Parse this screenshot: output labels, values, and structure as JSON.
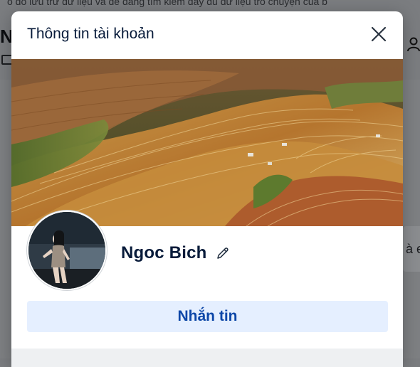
{
  "background": {
    "top_text": "ó do lưu trữ dữ liệu và dễ dàng tìm kiếm đầy đủ dữ liệu trò chuyện của b",
    "left_letter": "N",
    "right_card_text": "à e"
  },
  "modal": {
    "title": "Thông tin tài khoản",
    "close_icon": "close-icon"
  },
  "profile": {
    "name": "Ngoc Bich",
    "edit_icon": "pencil-icon",
    "message_button": "Nhắn tin"
  },
  "colors": {
    "title": "#081b3a",
    "button_bg": "#e5efff",
    "button_text": "#0d47a8"
  }
}
